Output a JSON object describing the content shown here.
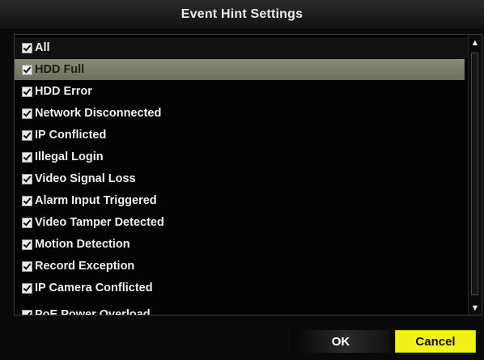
{
  "dialog": {
    "title": "Event Hint Settings"
  },
  "list": {
    "items": [
      {
        "label": "All",
        "checked": true
      },
      {
        "label": "HDD Full",
        "checked": true,
        "selected": true
      },
      {
        "label": "HDD Error",
        "checked": true
      },
      {
        "label": "Network Disconnected",
        "checked": true
      },
      {
        "label": "IP Conflicted",
        "checked": true
      },
      {
        "label": "Illegal Login",
        "checked": true
      },
      {
        "label": "Video Signal Loss",
        "checked": true
      },
      {
        "label": "Alarm Input Triggered",
        "checked": true
      },
      {
        "label": "Video Tamper Detected",
        "checked": true
      },
      {
        "label": "Motion Detection",
        "checked": true
      },
      {
        "label": "Record Exception",
        "checked": true
      },
      {
        "label": "IP Camera Conflicted",
        "checked": true
      },
      {
        "label": "PoE Power Overload",
        "checked": true
      }
    ]
  },
  "scrollbar": {
    "up_icon": "chevron-up-icon",
    "down_icon": "chevron-down-icon"
  },
  "buttons": {
    "ok_label": "OK",
    "cancel_label": "Cancel"
  },
  "colors": {
    "selected_row": "#7e806c",
    "cancel_bg": "#f2f21a",
    "background": "#0a0a0a"
  }
}
